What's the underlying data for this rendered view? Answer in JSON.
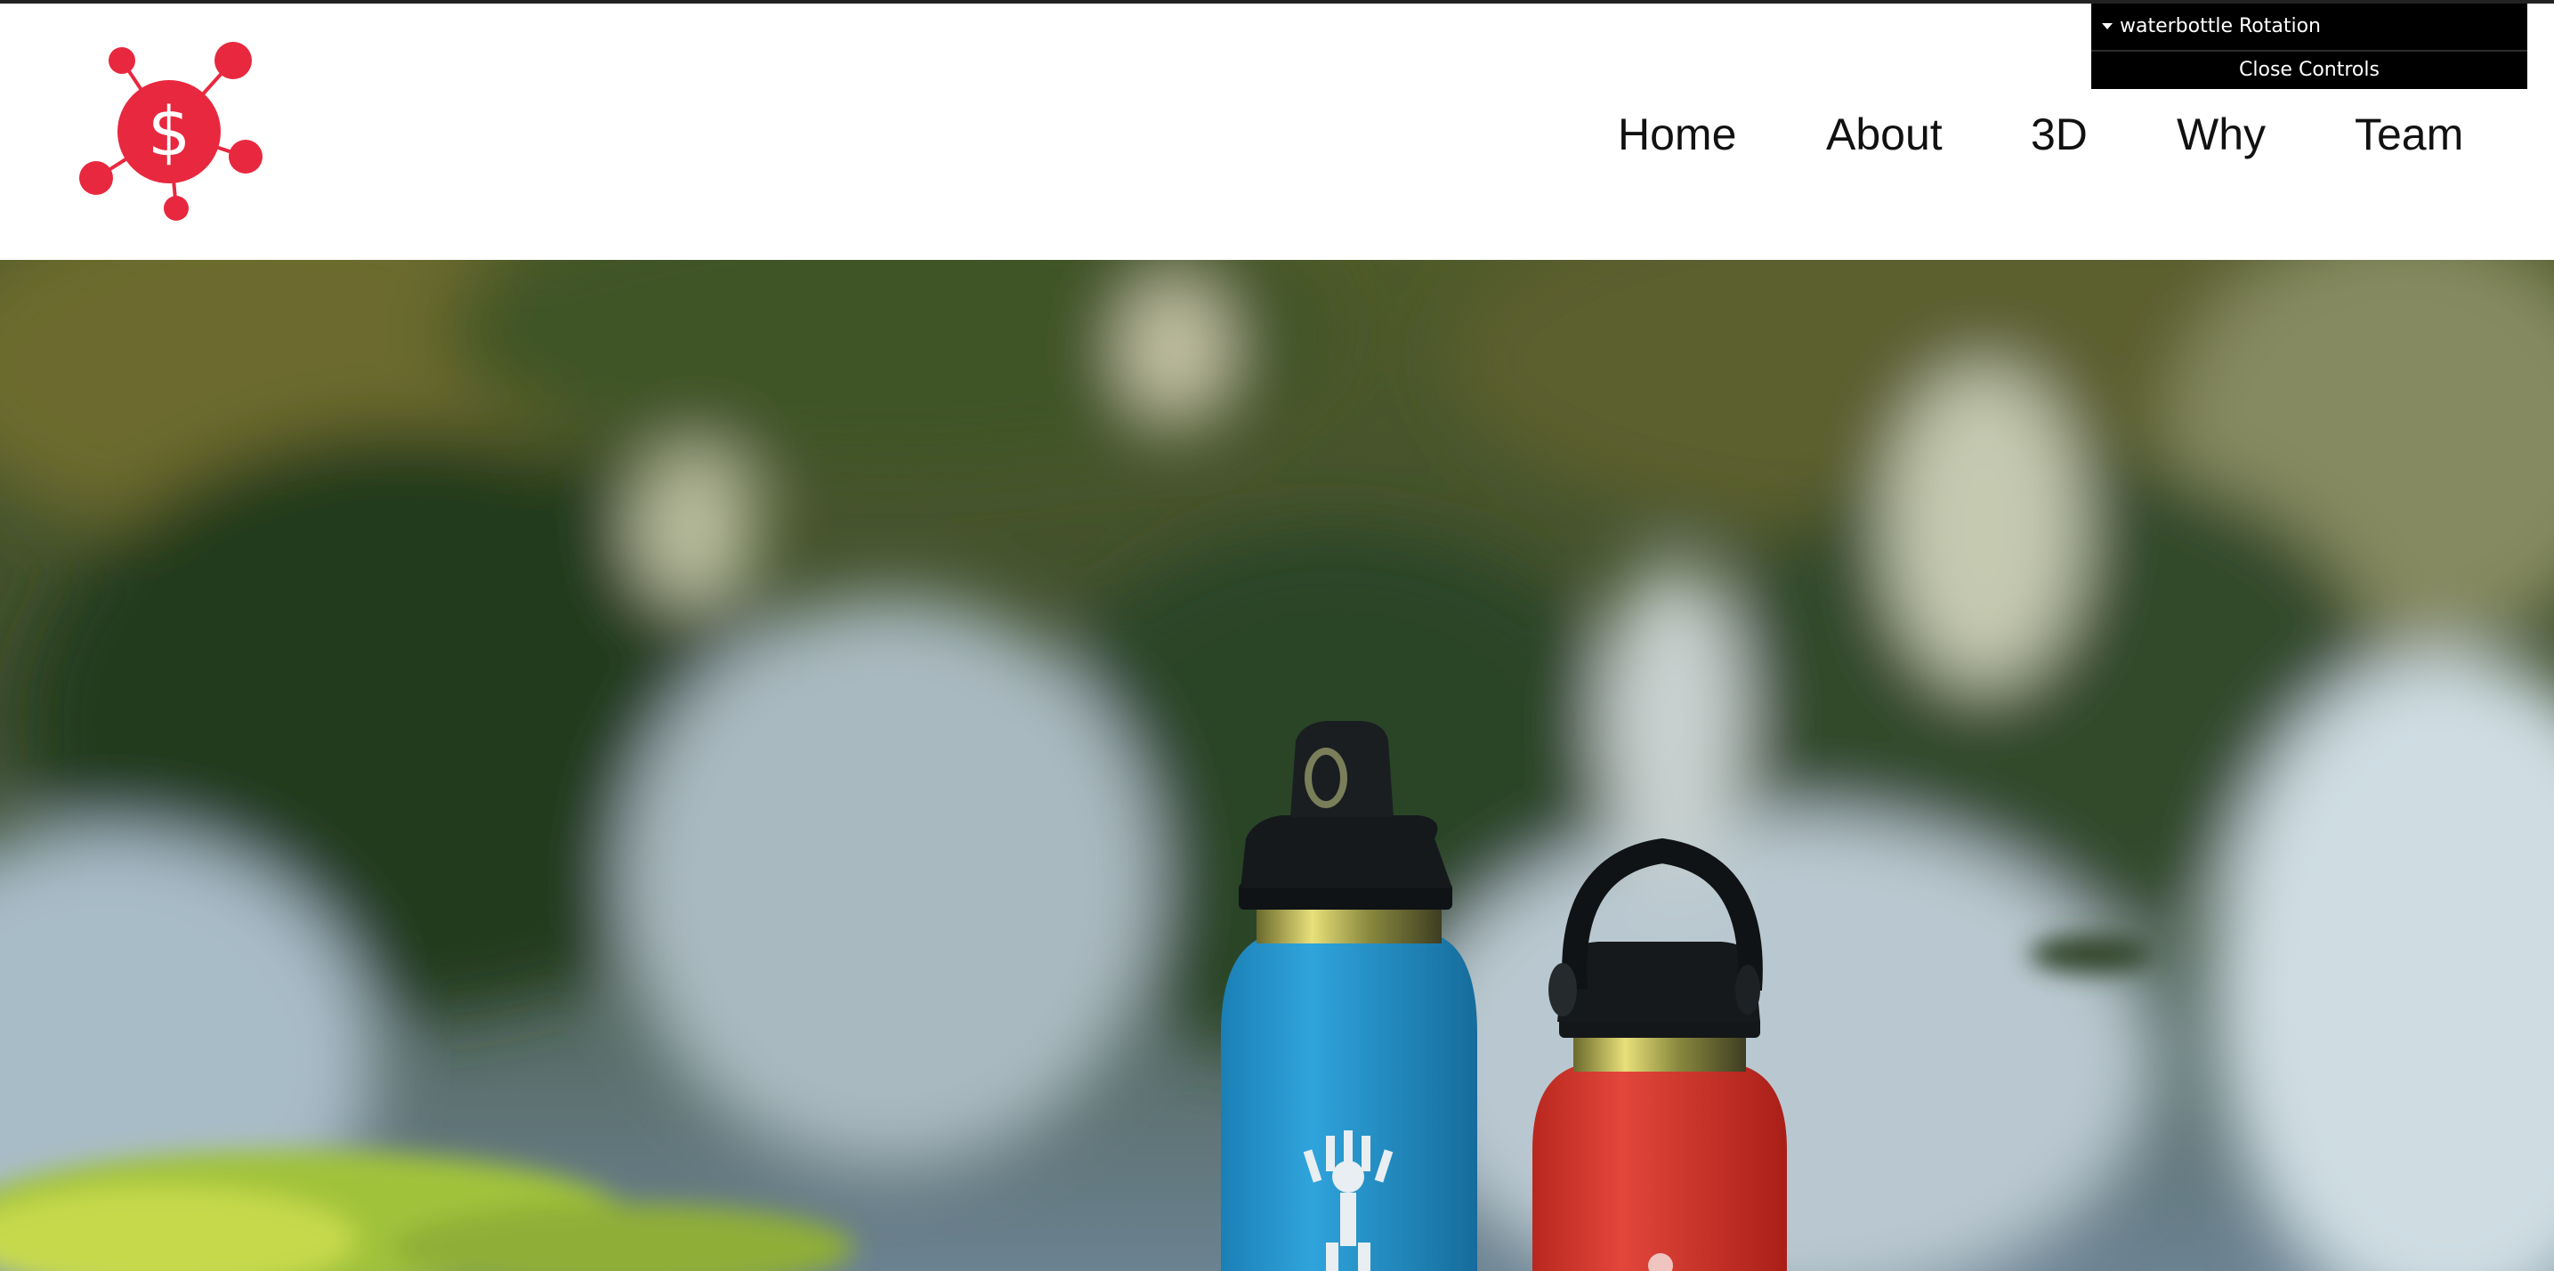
{
  "nav": {
    "items": [
      {
        "label": "Home"
      },
      {
        "label": "About"
      },
      {
        "label": "3D"
      },
      {
        "label": "Why"
      },
      {
        "label": "Team"
      }
    ]
  },
  "controls": {
    "folder_label": "waterbottle Rotation",
    "close_label": "Close Controls"
  },
  "colors": {
    "brand": "#e8283e",
    "nav_text": "#111111",
    "panel_bg": "#000000"
  },
  "icons": {
    "logo": "dollar-network-icon",
    "folder": "caret-down-icon"
  }
}
